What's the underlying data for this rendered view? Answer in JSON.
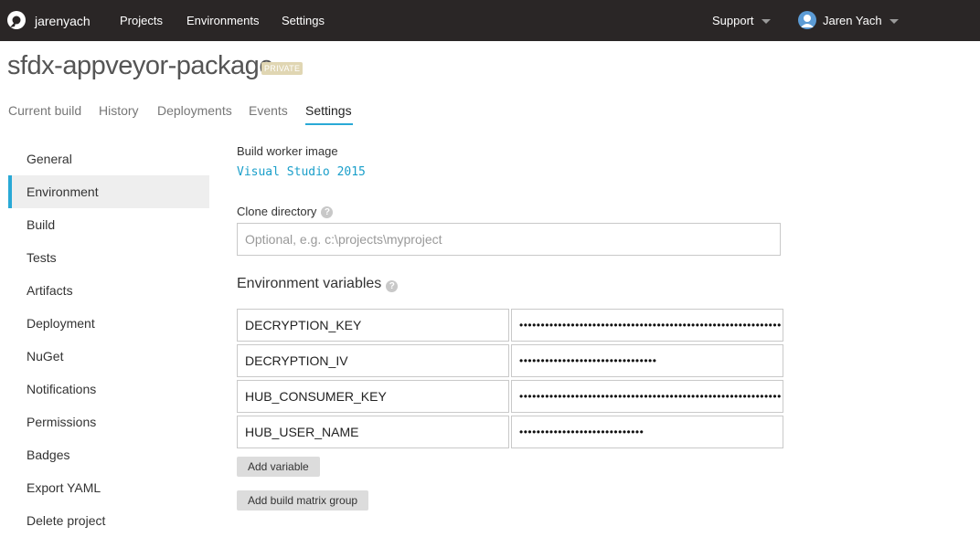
{
  "topbar": {
    "brand": "jarenyach",
    "nav": [
      "Projects",
      "Environments",
      "Settings"
    ],
    "support": "Support",
    "user": "Jaren Yach"
  },
  "project": {
    "name": "sfdx-appveyor-package",
    "badge": "PRIVATE"
  },
  "tabs": [
    "Current build",
    "History",
    "Deployments",
    "Events",
    "Settings"
  ],
  "active_tab": "Settings",
  "sidebar": {
    "items": [
      "General",
      "Environment",
      "Build",
      "Tests",
      "Artifacts",
      "Deployment",
      "NuGet",
      "Notifications",
      "Permissions",
      "Badges",
      "Export YAML",
      "Delete project"
    ],
    "active": "Environment"
  },
  "main": {
    "worker_image_label": "Build worker image",
    "worker_image_value": "Visual Studio 2015",
    "clone_dir_label": "Clone directory",
    "clone_dir_placeholder": "Optional, e.g. c:\\projects\\myproject",
    "clone_dir_value": "",
    "help_glyph": "?",
    "env_vars_title": "Environment variables",
    "env_vars": [
      {
        "name": "DECRYPTION_KEY",
        "value": "•••••••••••••••••••••••••••••••••••••••••••••••••••••••••••••"
      },
      {
        "name": "DECRYPTION_IV",
        "value": "••••••••••••••••••••••••••••••••"
      },
      {
        "name": "HUB_CONSUMER_KEY",
        "value": "•••••••••••••••••••••••••••••••••••••••••••••••••••••••••••••"
      },
      {
        "name": "HUB_USER_NAME",
        "value": "•••••••••••••••••••••••••••••"
      }
    ],
    "add_variable_label": "Add variable",
    "add_matrix_label": "Add build matrix group"
  },
  "colors": {
    "topbar": "#2a2626",
    "accent": "#29a9d6",
    "badge": "#e0d6b3"
  }
}
